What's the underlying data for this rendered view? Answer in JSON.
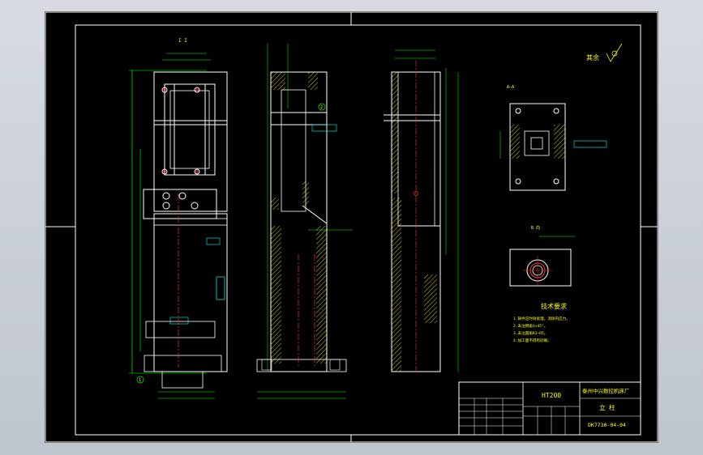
{
  "drawing": {
    "material": "HT200",
    "company": "泰州中兴数控机床厂",
    "part_name": "立  柱",
    "drawing_number": "DK7730-04-04",
    "section_label_aa": "A—A",
    "section_label_b": "B 向",
    "roughness_note": "其余",
    "tech_req_title": "技术要求",
    "tech_req": [
      "1.铸件应时效处理，消除内应力。",
      "2.未注倒角1×45°。",
      "3.未注圆角R3~R5。",
      "4.加工面不得有砂眼。"
    ],
    "callouts": [
      "1",
      "2"
    ],
    "view_label_left": "I I"
  },
  "colors": {
    "background": "#000000",
    "outline": "#ffffff",
    "dimension": "#00ff00",
    "text": "#ffff00",
    "centerline": "#ff3030",
    "hatch": "#ffff00"
  }
}
